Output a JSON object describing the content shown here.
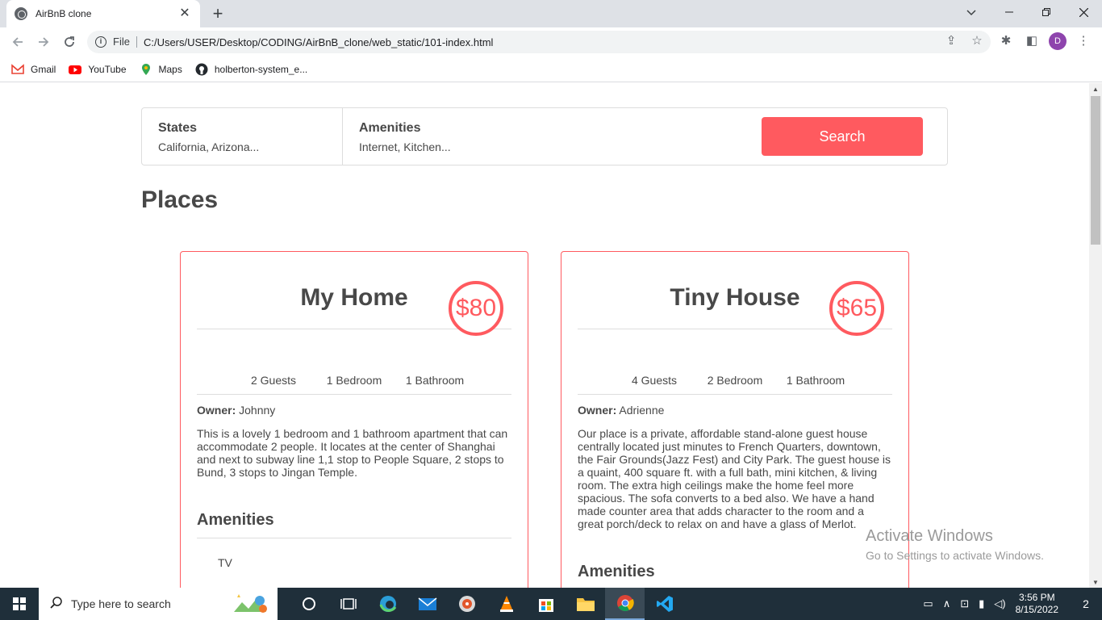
{
  "browser": {
    "tab_title": "AirBnB clone",
    "new_tab_symbol": "+",
    "close_symbol": "✕",
    "file_label": "File",
    "url": "C:/Users/USER/Desktop/CODING/AirBnB_clone/web_static/101-index.html",
    "profile_initial": "D",
    "bookmarks": [
      {
        "label": "Gmail",
        "icon": "gmail-icon"
      },
      {
        "label": "YouTube",
        "icon": "youtube-icon"
      },
      {
        "label": "Maps",
        "icon": "maps-icon"
      },
      {
        "label": "holberton-system_e...",
        "icon": "github-icon"
      }
    ]
  },
  "filters": {
    "states_title": "States",
    "states_value": "California, Arizona...",
    "amenities_title": "Amenities",
    "amenities_value": "Internet, Kitchen...",
    "search_label": "Search"
  },
  "places": {
    "title": "Places",
    "items": [
      {
        "title": "My Home",
        "price": "$80",
        "guests": "2 Guests",
        "bedrooms": "1 Bedroom",
        "bathrooms": "1 Bathroom",
        "owner_label": "Owner:",
        "owner": " Johnny",
        "description": "This is a lovely 1 bedroom and 1 bathroom apartment that can accommodate 2 people. It locates at the center of Shanghai and next to subway line 1,1 stop to People Square, 2 stops to Bund, 3 stops to Jingan Temple.",
        "amenities_title": "Amenities",
        "amenities": [
          "TV"
        ]
      },
      {
        "title": "Tiny House",
        "price": "$65",
        "guests": "4 Guests",
        "bedrooms": "2 Bedroom",
        "bathrooms": "1 Bathroom",
        "owner_label": "Owner:",
        "owner": " Adrienne",
        "description": "Our place is a private, affordable stand-alone guest house centrally located just minutes to French Quarters, downtown, the Fair Grounds(Jazz Fest) and City Park. The guest house is a quaint, 400 square ft. with a full bath, mini kitchen, & living room. The extra high ceilings make the home feel more spacious. The sofa converts to a bed also. We have a hand made counter area that adds character to the room and a great porch/deck to relax on and have a glass of Merlot.",
        "amenities_title": "Amenities",
        "amenities": []
      }
    ]
  },
  "watermark": {
    "line1": "Activate Windows",
    "line2": "Go to Settings to activate Windows."
  },
  "taskbar": {
    "search_placeholder": "Type here to search",
    "time": "3:56 PM",
    "date": "8/15/2022",
    "notification_count": "2"
  },
  "colors": {
    "accent": "#ff5a5f",
    "text": "#484848",
    "border": "#dddddd"
  }
}
